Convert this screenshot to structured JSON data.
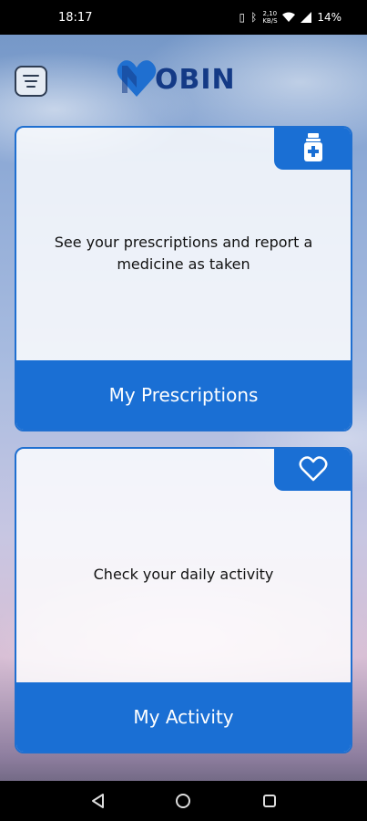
{
  "status_bar": {
    "time": "18:17",
    "icons": [
      "vibrate-icon",
      "bluetooth-icon",
      "data-speed-icon",
      "wifi-icon",
      "signal-icon"
    ],
    "data_speed": "2,10 KB/S",
    "battery": "14%"
  },
  "header": {
    "menu_icon": "menu-icon",
    "logo_text": "OBIN",
    "logo_colors": {
      "heart": "#1f6fd0",
      "text": "#143a86"
    }
  },
  "cards": [
    {
      "id": "prescriptions",
      "icon": "medicine-bottle-icon",
      "description": "See your prescriptions and report a medicine as taken",
      "button_label": "My Prescriptions"
    },
    {
      "id": "activity",
      "icon": "heart-icon",
      "description": "Check your daily activity",
      "button_label": "My Activity"
    }
  ],
  "nav_bar": {
    "buttons": [
      "back-icon",
      "home-icon",
      "recents-icon"
    ]
  },
  "colors": {
    "accent": "#1a6fd4",
    "card_border": "#1f6fd0"
  }
}
